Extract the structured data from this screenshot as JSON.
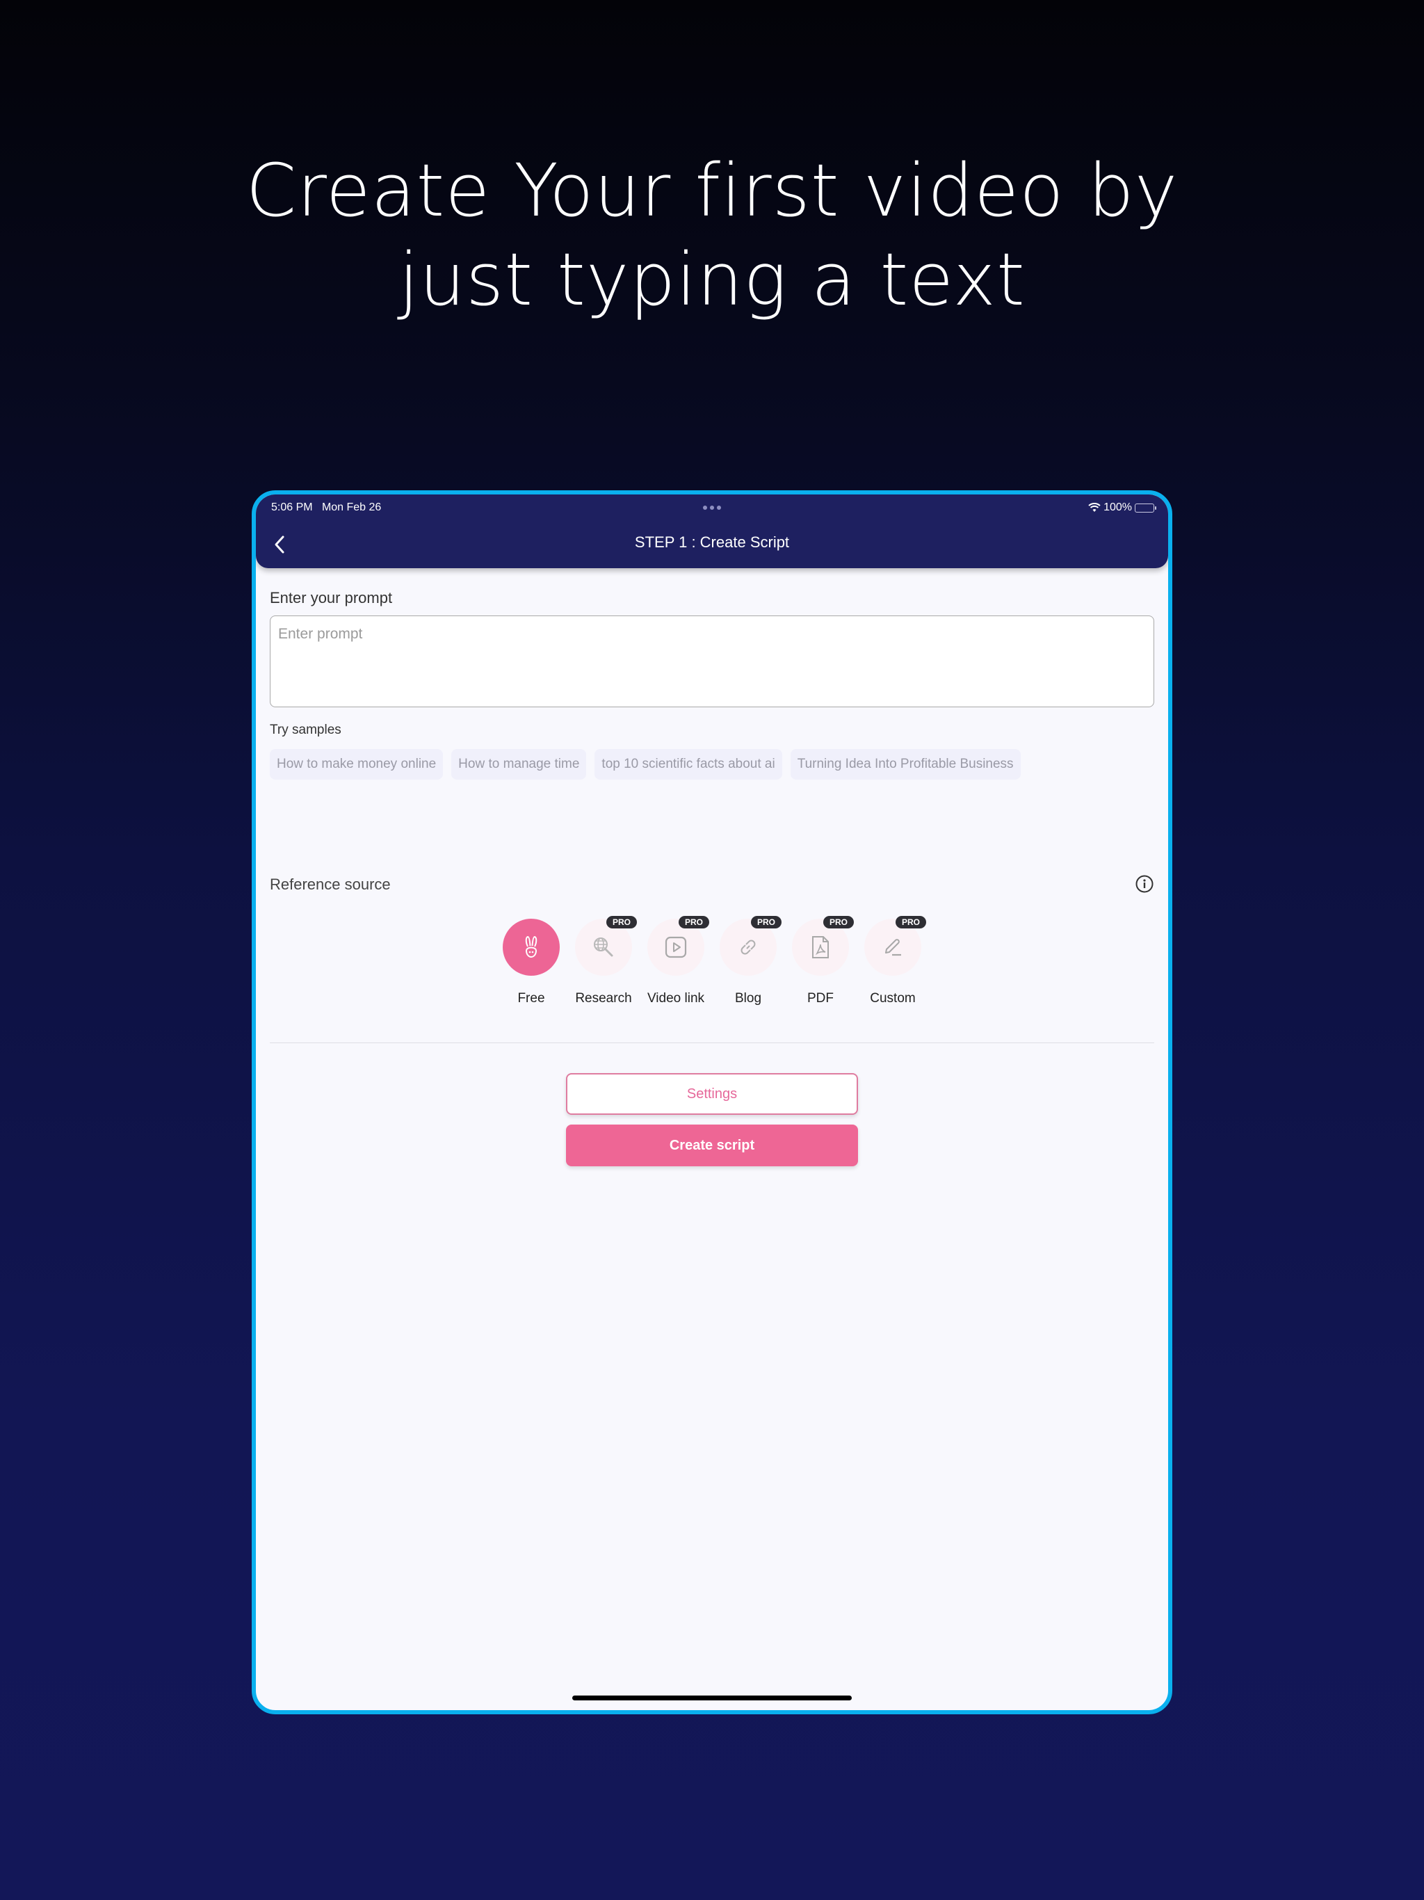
{
  "headline": {
    "line1": "Create Your first video by",
    "line2": "just typing a text"
  },
  "status_bar": {
    "time": "5:06 PM",
    "date": "Mon Feb 26",
    "battery": "100%",
    "battery_level": 1.0,
    "icons": [
      "wifi-icon",
      "battery-icon"
    ]
  },
  "navbar": {
    "title": "STEP 1 : Create Script",
    "back_icon": "chevron-left-icon"
  },
  "prompt": {
    "label": "Enter your prompt",
    "placeholder": "Enter prompt",
    "value": ""
  },
  "samples": {
    "label": "Try samples",
    "items": [
      "How to make money online",
      "How to manage time",
      "top 10 scientific facts about ai",
      "Turning Idea Into Profitable Business"
    ]
  },
  "reference": {
    "label": "Reference source",
    "info_icon": "info-icon",
    "sources": [
      {
        "name": "Free",
        "icon": "rabbit-icon",
        "badge": "",
        "selected": true
      },
      {
        "name": "Research",
        "icon": "globe-search-icon",
        "badge": "PRO",
        "selected": false
      },
      {
        "name": "Video link",
        "icon": "play-icon",
        "badge": "PRO",
        "selected": false
      },
      {
        "name": "Blog",
        "icon": "link-icon",
        "badge": "PRO",
        "selected": false
      },
      {
        "name": "PDF",
        "icon": "pdf-icon",
        "badge": "PRO",
        "selected": false
      },
      {
        "name": "Custom",
        "icon": "pencil-icon",
        "badge": "PRO",
        "selected": false
      }
    ]
  },
  "actions": {
    "settings_label": "Settings",
    "create_label": "Create script"
  },
  "colors": {
    "accent": "#ee6695",
    "navbar": "#1e2060",
    "device_border": "#0ab0ee",
    "pro_badge": "#2e2e34"
  }
}
